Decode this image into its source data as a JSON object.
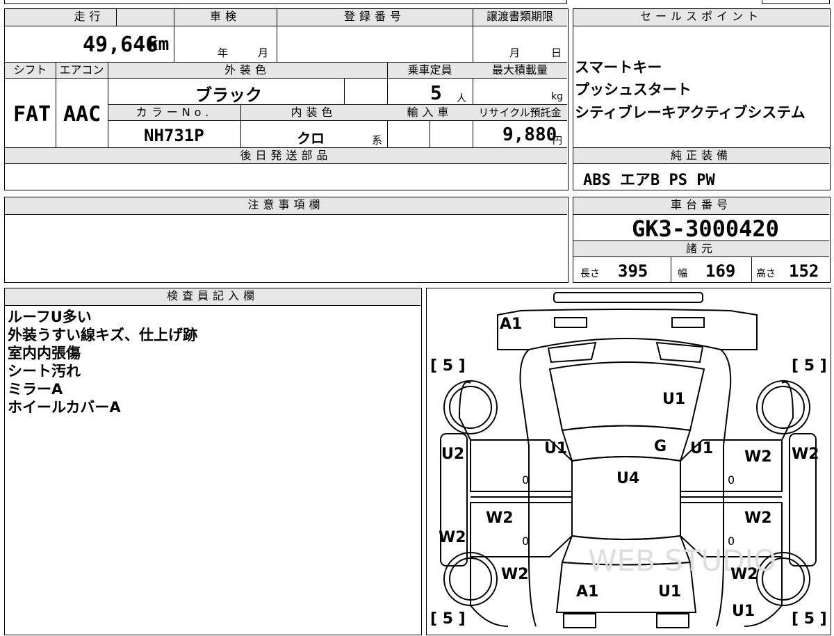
{
  "vehicle": {
    "mileage_label": "走行",
    "mileage_value": "49,646",
    "mileage_unit": "km",
    "inspection_label": "車検",
    "year_unit": "年",
    "month_unit": "月",
    "registration_label": "登録番号",
    "transfer_label": "譲渡書類期限",
    "day_unit": "日",
    "shift_label": "シフト",
    "shift_value": "FAT",
    "ac_label": "エアコン",
    "ac_value": "AAC",
    "exterior_label": "外装色",
    "exterior_value": "ブラック",
    "capacity_label": "乗車定員",
    "capacity_value": "5",
    "capacity_unit": "人",
    "maxload_label": "最大積載量",
    "maxload_unit": "kg",
    "colorno_label": "カラーNo.",
    "colorno_value": "NH731P",
    "interior_label": "内装色",
    "interior_value": "クロ",
    "interior_unit": "系",
    "import_label": "輸入車",
    "recycle_label": "リサイクル預託金",
    "recycle_value": "9,880",
    "recycle_unit": "円",
    "later_parts_label": "後日発送部品"
  },
  "sales": {
    "label": "セールスポイント",
    "items": [
      "スマートキー",
      "プッシュスタート",
      "シティブレーキアクティブシステム"
    ]
  },
  "equipment": {
    "label": "純正装備",
    "value": "ABS エアB PS PW"
  },
  "notes": {
    "label": "注意事項欄"
  },
  "chassis": {
    "label": "車台番号",
    "value": "GK3-3000420"
  },
  "specs": {
    "label": "諸元",
    "length_label": "長さ",
    "length_value": "395",
    "width_label": "幅",
    "width_value": "169",
    "height_label": "高さ",
    "height_value": "152"
  },
  "inspector": {
    "label": "検査員記入欄",
    "lines": [
      "ルーフU多い",
      "外装うすい線キズ、仕上げ跡",
      "室内内張傷",
      "シート汚れ",
      "ミラーA",
      "ホイールカバーA"
    ]
  },
  "diagram": {
    "tire_marks": [
      "[ 5 ]",
      "[ 5 ]",
      "[ 5 ]",
      "[ 5 ]"
    ],
    "codes": {
      "a1_top": "A1",
      "u1_hood": "U1",
      "u1_left_pillar": "U1",
      "g_windshield": "G",
      "u1_right_pillar": "U1",
      "u2_left": "U2",
      "w2_right_fender": "W2",
      "w2_right_edge": "W2",
      "u4_roof": "U4",
      "w2_left_door": "W2",
      "w2_right_door": "W2",
      "w2_left_edge": "W2",
      "w2_left_rear": "W2",
      "w2_right_rear": "W2",
      "a1_rear": "A1",
      "u1_rear": "U1",
      "u1_right_rear": "U1"
    },
    "door_marks": [
      "0",
      "0",
      "0",
      "0"
    ],
    "watermark": "WEB STUDIO"
  }
}
